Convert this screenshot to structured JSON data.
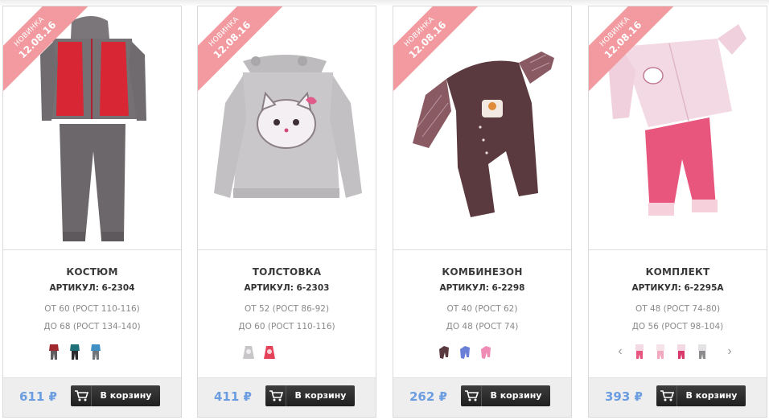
{
  "colors": {
    "price": "#6b9de0",
    "ribbon": "#f29a9f",
    "button": "#2a2a2a"
  },
  "cart_label": "В корзину",
  "products": [
    {
      "badge": "НОВИНКА",
      "date": "12.08.16",
      "name": "КОСТЮМ",
      "sku": "АРТИКУЛ: 6-2304",
      "size_from": "ОТ 60 (РОСТ 110-116)",
      "size_to": "ДО 68 (РОСТ 134-140)",
      "price": "611 ₽",
      "variants": [
        "red-grey",
        "teal-black",
        "blue-grey"
      ]
    },
    {
      "badge": "НОВИНКА",
      "date": "12.08.16",
      "name": "ТОЛСТОВКА",
      "sku": "АРТИКУЛ: 6-2303",
      "size_from": "ОТ 52 (РОСТ 86-92)",
      "size_to": "ДО 60 (РОСТ 110-116)",
      "price": "411 ₽",
      "variants": [
        "light-grey",
        "pink-red"
      ]
    },
    {
      "badge": "НОВИНКА",
      "date": "12.08.16",
      "name": "КОМБИНЕЗОН",
      "sku": "АРТИКУЛ: 6-2298",
      "size_from": "ОТ 40 (РОСТ 62)",
      "size_to": "ДО 48 (РОСТ 74)",
      "price": "262 ₽",
      "variants": [
        "brown",
        "blue",
        "pink"
      ]
    },
    {
      "badge": "НОВИНКА",
      "date": "12.08.16",
      "name": "КОМПЛЕКТ",
      "sku": "АРТИКУЛ: 6-2295А",
      "size_from": "ОТ 48 (РОСТ 74-80)",
      "size_to": "ДО 56 (РОСТ 98-104)",
      "price": "393 ₽",
      "variants": [
        "pink-light",
        "pink-pale",
        "pink-hot",
        "grey"
      ]
    }
  ]
}
